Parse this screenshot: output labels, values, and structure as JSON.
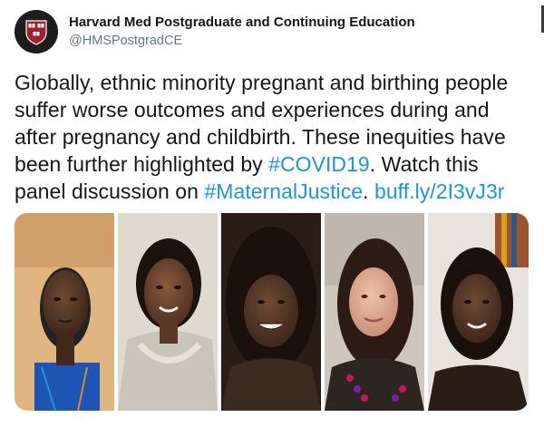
{
  "account": {
    "display_name": "Harvard Med Postgraduate and Continuing Education",
    "handle": "@HMSPostgradCE",
    "avatar_icon": "harvard-shield-icon"
  },
  "tweet": {
    "text_part1": "Globally, ethnic minority pregnant and birthing people suffer worse outcomes and experiences during and after pregnancy and childbirth. These inequities have been further highlighted by ",
    "hashtag_covid": "#COVID19",
    "text_part2": ". Watch this panel discussion on ",
    "hashtag_maternal": "#MaternalJustice",
    "text_part3": ". ",
    "link": "buff.ly/2I3vJ3r"
  },
  "media": {
    "panelists": 5
  },
  "colors": {
    "link": "#1b95e0",
    "text": "#14171a",
    "secondary": "#657786",
    "shield_red": "#a51c30"
  }
}
